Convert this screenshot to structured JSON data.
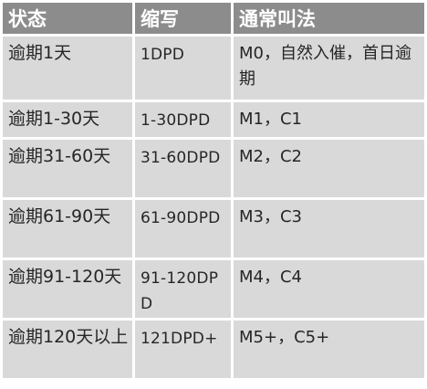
{
  "table": {
    "headers": {
      "status": "状态",
      "abbreviation": "缩写",
      "common_name": "通常叫法"
    },
    "rows": [
      {
        "status": "逾期1天",
        "abbreviation": "1DPD",
        "common_name": "M0，自然入催，首日逾期"
      },
      {
        "status": "逾期1-30天",
        "abbreviation": "1-30DPD",
        "common_name": "M1，C1"
      },
      {
        "status": "逾期31-60天",
        "abbreviation": "31-60DPD",
        "common_name": "M2，C2"
      },
      {
        "status": "逾期61-90天",
        "abbreviation": "61-90DPD",
        "common_name": "M3，C3"
      },
      {
        "status": "逾期91-120天",
        "abbreviation": "91-120DPD",
        "common_name": "M4，C4"
      },
      {
        "status": "逾期120天以上",
        "abbreviation": "121DPD+",
        "common_name": "M5+，C5+"
      }
    ]
  },
  "colors": {
    "header_bg": "#8c8c8c",
    "header_text": "#ffffff",
    "cell_bg": "#d9d9d9",
    "cell_text": "#262626",
    "grid_line": "#ffffff"
  }
}
